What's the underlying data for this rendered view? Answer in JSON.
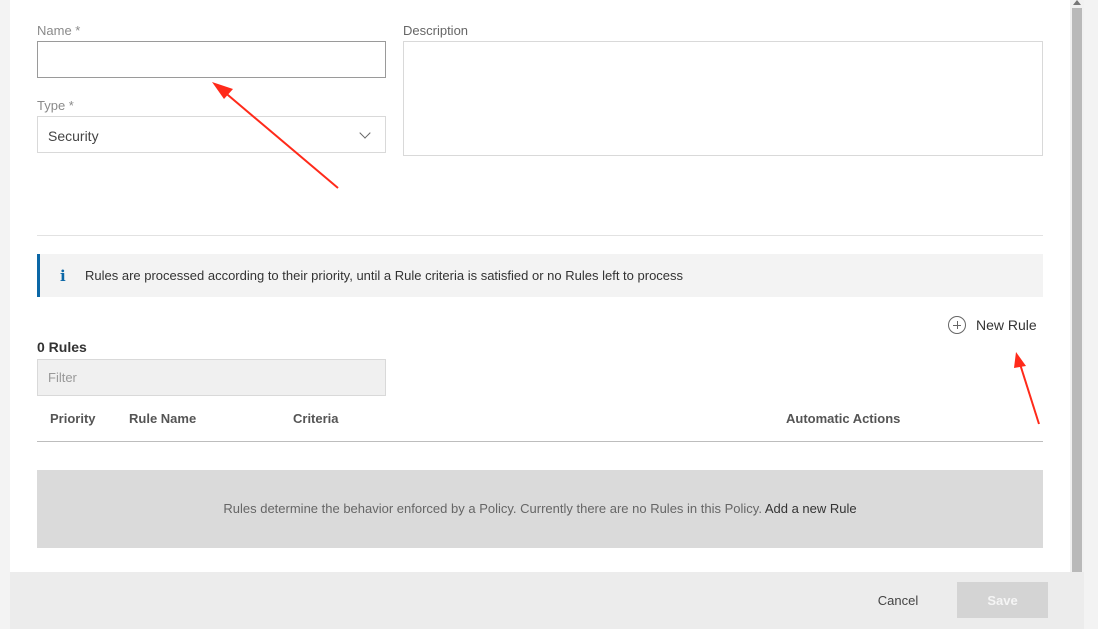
{
  "form": {
    "name_label": "Name *",
    "name_value": "",
    "type_label": "Type *",
    "type_value": "Security",
    "description_label": "Description",
    "description_value": ""
  },
  "info": {
    "icon": "info-icon",
    "text": "Rules are processed according to their priority, until a Rule criteria is satisfied or no Rules left to process"
  },
  "rules": {
    "new_rule_icon": "plus-circle-icon",
    "new_rule_label": "New Rule",
    "count_label": "0 Rules",
    "filter_placeholder": "Filter",
    "columns": [
      "Priority",
      "Rule Name",
      "Criteria",
      "Automatic Actions"
    ],
    "empty_text": "Rules determine the behavior enforced by a Policy. Currently there are no Rules in this Policy.",
    "empty_link": "Add a new Rule"
  },
  "footer": {
    "cancel_label": "Cancel",
    "save_label": "Save"
  },
  "colors": {
    "accent": "#0b67a6",
    "annotation_arrow": "#ff2a1a"
  }
}
